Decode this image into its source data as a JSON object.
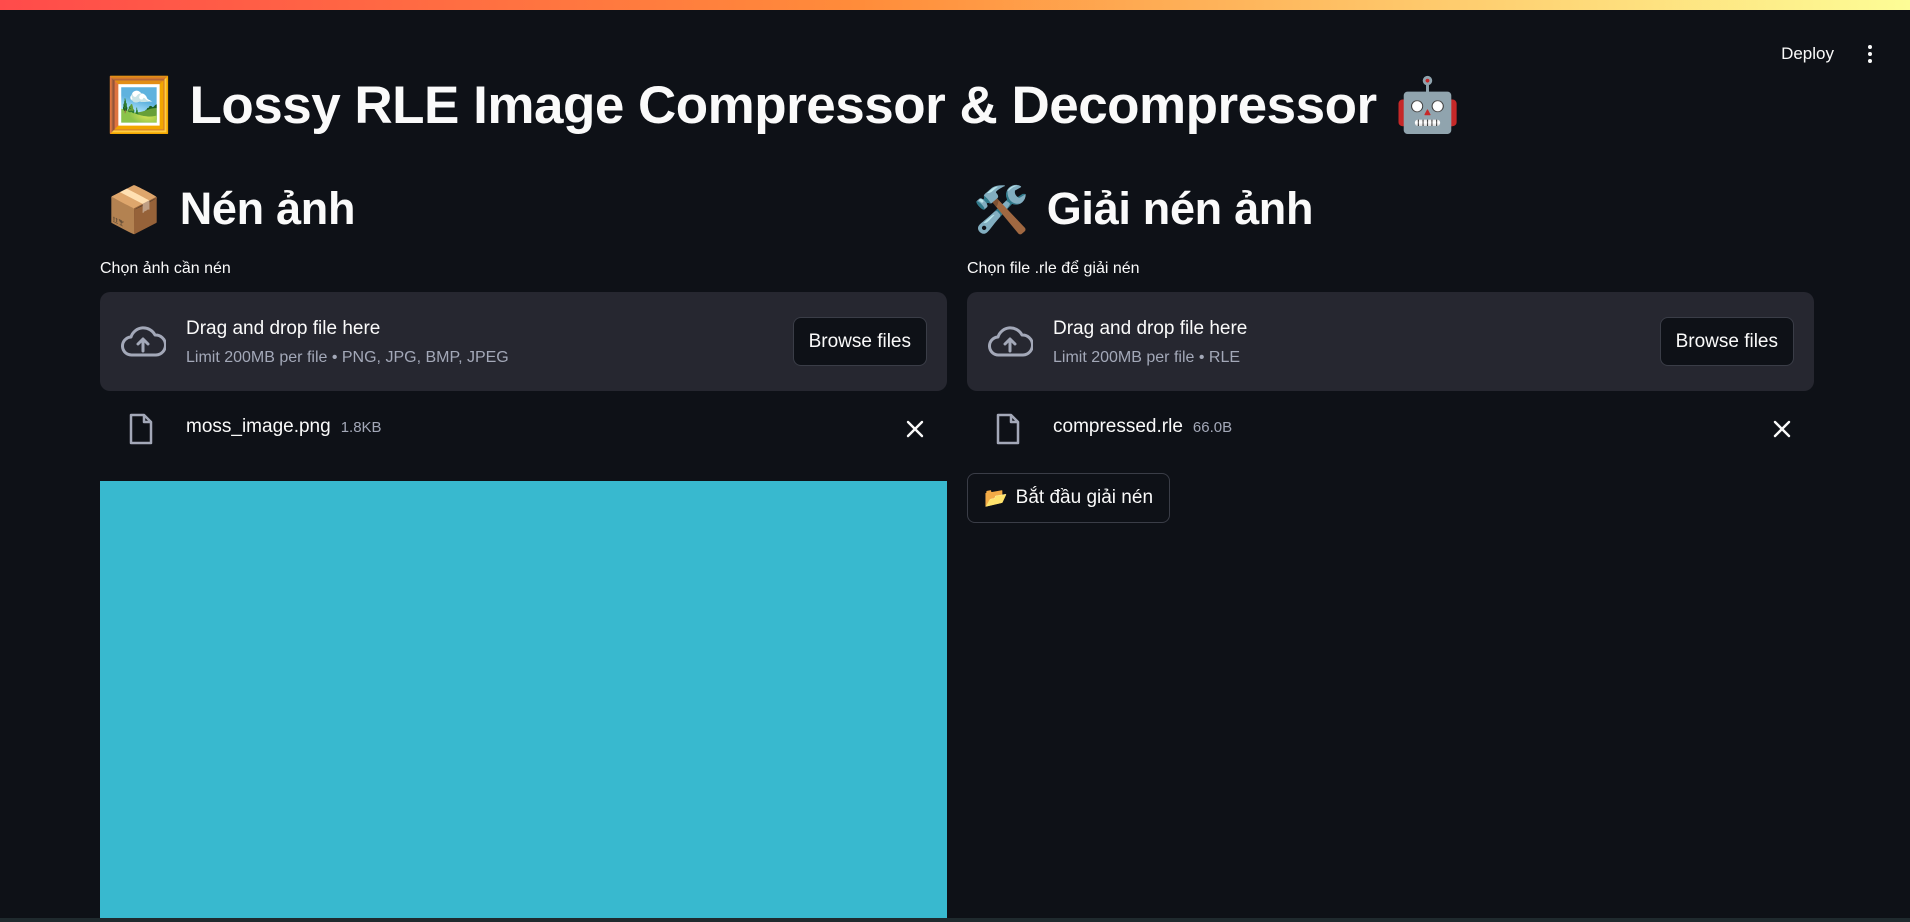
{
  "header": {
    "deploy_label": "Deploy",
    "menu_icon": "more-vert-icon"
  },
  "page": {
    "title_emoji_left": "🖼️",
    "title": "Lossy RLE Image Compressor & Decompressor",
    "title_emoji_right": "🤖"
  },
  "compress": {
    "emoji": "📦",
    "title": "Nén ảnh",
    "field_label": "Chọn ảnh cần nén",
    "dropzone": {
      "primary": "Drag and drop file here",
      "secondary": "Limit 200MB per file • PNG, JPG, BMP, JPEG",
      "browse_label": "Browse files"
    },
    "file": {
      "name": "moss_image.png",
      "size": "1.8KB"
    },
    "preview_color": "#38b9cf"
  },
  "decompress": {
    "emoji": "🛠️",
    "title": "Giải nén ảnh",
    "field_label": "Chọn file .rle để giải nén",
    "dropzone": {
      "primary": "Drag and drop file here",
      "secondary": "Limit 200MB per file • RLE",
      "browse_label": "Browse files"
    },
    "file": {
      "name": "compressed.rle",
      "size": "66.0B"
    },
    "start_button": {
      "emoji": "📂",
      "label": "Bắt đầu giải nén"
    }
  },
  "colors": {
    "background": "#0e1117",
    "dropzone": "#262730",
    "accent_gradient_start": "#ff4b4b",
    "accent_gradient_end": "#fdfd96"
  }
}
